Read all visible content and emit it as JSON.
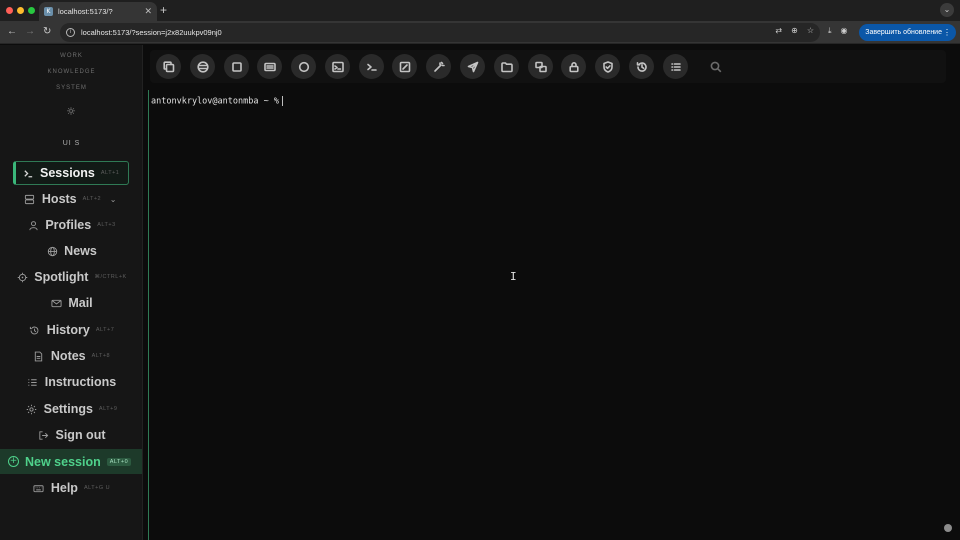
{
  "browser": {
    "tab_title": "localhost:5173/?",
    "tab_favicon_glyph": "K",
    "url": "localhost:5173/?session=j2x82uukpv09nj0",
    "update_button_label": "Завершить обновление",
    "icons": {
      "back": "arrow-left-icon",
      "forward": "arrow-right-icon",
      "reload": "reload-icon",
      "site_info": "info-icon",
      "translate": "translate-icon",
      "zoom": "zoom-icon",
      "bookmark": "star-icon",
      "download": "download-icon",
      "profile": "profile-icon",
      "menu": "more-vertical-icon"
    }
  },
  "sidebar": {
    "categories": [
      "WORK",
      "KNOWLEDGE",
      "SYSTEM"
    ],
    "theme_icon": "sun-icon",
    "ui_label": "UI S",
    "items": [
      {
        "label": "Sessions",
        "shortcut": "ALT+1",
        "icon": "terminal-icon"
      },
      {
        "label": "Hosts",
        "shortcut": "ALT+2",
        "icon": "server-icon",
        "expand": "chevron-down-icon"
      },
      {
        "label": "Profiles",
        "shortcut": "ALT+3",
        "icon": "user-icon"
      },
      {
        "label": "News",
        "shortcut": "",
        "icon": "globe-icon"
      },
      {
        "label": "Spotlight",
        "shortcut": "⌘/CTRL+K",
        "icon": "crosshair-icon"
      },
      {
        "label": "Mail",
        "shortcut": "",
        "icon": "mail-icon"
      },
      {
        "label": "History",
        "shortcut": "ALT+7",
        "icon": "history-icon"
      },
      {
        "label": "Notes",
        "shortcut": "ALT+8",
        "icon": "note-icon"
      },
      {
        "label": "Instructions",
        "shortcut": "",
        "icon": "list-icon"
      },
      {
        "label": "Settings",
        "shortcut": "ALT+9",
        "icon": "gear-icon"
      },
      {
        "label": "Sign out",
        "shortcut": "",
        "icon": "sign-out-icon"
      },
      {
        "label": "New session",
        "shortcut": "ALT+0",
        "icon": "plus-circle-icon"
      },
      {
        "label": "Help",
        "shortcut": "ALT+G U",
        "icon": "keyboard-icon"
      }
    ]
  },
  "toolbar": {
    "buttons": [
      "copy-icon",
      "database-icon",
      "square-icon",
      "keyboard-icon",
      "circle-icon",
      "terminal-window-icon",
      "prompt-icon",
      "edit-icon",
      "magic-wand-icon",
      "send-icon",
      "folder-icon",
      "transfer-icon",
      "lock-icon",
      "shield-check-icon",
      "history-icon",
      "list-icon"
    ],
    "search_icon": "search-icon"
  },
  "terminal": {
    "prompt": "antonvkrylov@antonmba ~ %"
  }
}
